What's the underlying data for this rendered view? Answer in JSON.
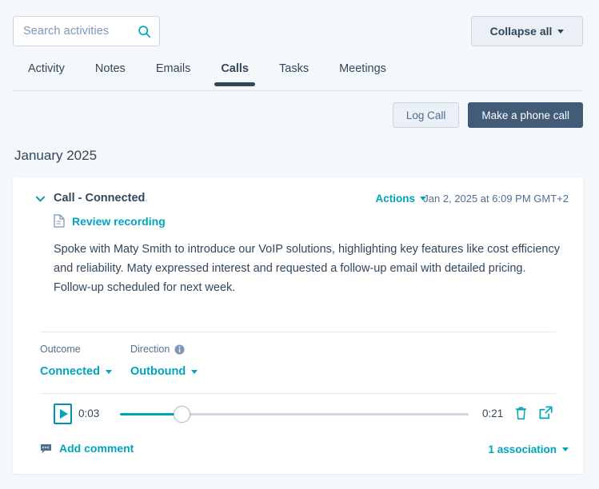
{
  "colors": {
    "page_bg": "#f5f8fa",
    "teal": "#00a4bd",
    "primary_btn": "#425b76",
    "text": "#33475b",
    "muted": "#516f90"
  },
  "search": {
    "placeholder": "Search activities",
    "value": "",
    "icon": "search-icon"
  },
  "header": {
    "collapse_label": "Collapse all"
  },
  "tabs": [
    {
      "label": "Activity",
      "active": false
    },
    {
      "label": "Notes",
      "active": false
    },
    {
      "label": "Emails",
      "active": false
    },
    {
      "label": "Calls",
      "active": true
    },
    {
      "label": "Tasks",
      "active": false
    },
    {
      "label": "Meetings",
      "active": false
    }
  ],
  "actions": {
    "log_call_label": "Log Call",
    "make_call_label": "Make a phone call"
  },
  "month_heading": "January 2025",
  "call": {
    "title": "Call - Connected",
    "title_suffix": ".",
    "actions_label": "Actions",
    "timestamp": "Jan 2, 2025 at 6:09 PM GMT+2",
    "review_label": "Review recording",
    "review_icon": "document-icon",
    "body": "Spoke with Maty Smith to introduce our VoIP solutions, highlighting key features like cost efficiency and reliability. Maty expressed interest and requested a follow-up email with detailed pricing.\nFollow-up scheduled for next week.",
    "outcome": {
      "label": "Outcome",
      "value": "Connected"
    },
    "direction": {
      "label": "Direction",
      "value": "Outbound",
      "has_info_icon": true
    },
    "player": {
      "current_time": "0:03",
      "total_time": "0:21",
      "progress_percent": 18,
      "play_icon": "play-icon",
      "delete_icon": "trash-icon",
      "open_icon": "external-link-icon"
    },
    "add_comment_label": "Add comment",
    "associations_label": "1 association"
  }
}
